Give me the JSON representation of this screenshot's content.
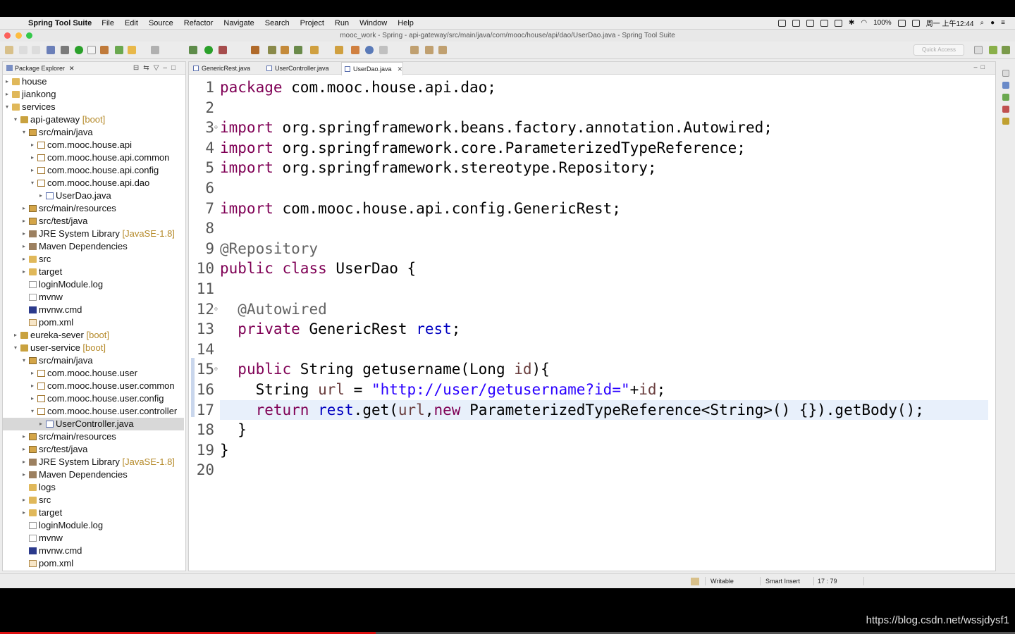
{
  "menubar": {
    "app_name": "Spring Tool Suite",
    "items": [
      "File",
      "Edit",
      "Source",
      "Refactor",
      "Navigate",
      "Search",
      "Project",
      "Run",
      "Window",
      "Help"
    ],
    "battery": "100%",
    "clock": "周一 上午12:44"
  },
  "window": {
    "title": "mooc_work - Spring - api-gateway/src/main/java/com/mooc/house/api/dao/UserDao.java - Spring Tool Suite"
  },
  "toolbar": {
    "quick_access_placeholder": "Quick Access"
  },
  "explorer": {
    "title": "Package Explorer",
    "rows": [
      {
        "label": "house",
        "deco": "",
        "icon": "folder"
      },
      {
        "label": "jiankong",
        "deco": "",
        "icon": "folder"
      },
      {
        "label": "services",
        "deco": "",
        "icon": "folder"
      },
      {
        "label": "api-gateway",
        "deco": "[boot]",
        "icon": "project"
      },
      {
        "label": "src/main/java",
        "deco": "",
        "icon": "srcfolder"
      },
      {
        "label": "com.mooc.house.api",
        "deco": "",
        "icon": "package"
      },
      {
        "label": "com.mooc.house.api.common",
        "deco": "",
        "icon": "package"
      },
      {
        "label": "com.mooc.house.api.config",
        "deco": "",
        "icon": "package"
      },
      {
        "label": "com.mooc.house.api.dao",
        "deco": "",
        "icon": "package"
      },
      {
        "label": "UserDao.java",
        "deco": "",
        "icon": "java"
      },
      {
        "label": "src/main/resources",
        "deco": "",
        "icon": "srcfolder"
      },
      {
        "label": "src/test/java",
        "deco": "",
        "icon": "srcfolder"
      },
      {
        "label": "JRE System Library",
        "deco": "[JavaSE-1.8]",
        "icon": "lib"
      },
      {
        "label": "Maven Dependencies",
        "deco": "",
        "icon": "lib"
      },
      {
        "label": "src",
        "deco": "",
        "icon": "folder"
      },
      {
        "label": "target",
        "deco": "",
        "icon": "folder"
      },
      {
        "label": "loginModule.log",
        "deco": "",
        "icon": "file"
      },
      {
        "label": "mvnw",
        "deco": "",
        "icon": "file"
      },
      {
        "label": "mvnw.cmd",
        "deco": "",
        "icon": "cmd"
      },
      {
        "label": "pom.xml",
        "deco": "",
        "icon": "xml"
      },
      {
        "label": "eureka-sever",
        "deco": "[boot]",
        "icon": "project"
      },
      {
        "label": "user-service",
        "deco": "[boot]",
        "icon": "project"
      },
      {
        "label": "src/main/java",
        "deco": "",
        "icon": "srcfolder"
      },
      {
        "label": "com.mooc.house.user",
        "deco": "",
        "icon": "package"
      },
      {
        "label": "com.mooc.house.user.common",
        "deco": "",
        "icon": "package"
      },
      {
        "label": "com.mooc.house.user.config",
        "deco": "",
        "icon": "package"
      },
      {
        "label": "com.mooc.house.user.controller",
        "deco": "",
        "icon": "package"
      },
      {
        "label": "UserController.java",
        "deco": "",
        "icon": "java"
      },
      {
        "label": "src/main/resources",
        "deco": "",
        "icon": "srcfolder"
      },
      {
        "label": "src/test/java",
        "deco": "",
        "icon": "srcfolder"
      },
      {
        "label": "JRE System Library",
        "deco": "[JavaSE-1.8]",
        "icon": "lib"
      },
      {
        "label": "Maven Dependencies",
        "deco": "",
        "icon": "lib"
      },
      {
        "label": "logs",
        "deco": "",
        "icon": "folder"
      },
      {
        "label": "src",
        "deco": "",
        "icon": "folder"
      },
      {
        "label": "target",
        "deco": "",
        "icon": "folder"
      },
      {
        "label": "loginModule.log",
        "deco": "",
        "icon": "file"
      },
      {
        "label": "mvnw",
        "deco": "",
        "icon": "file"
      },
      {
        "label": "mvnw.cmd",
        "deco": "",
        "icon": "cmd"
      },
      {
        "label": "pom.xml",
        "deco": "",
        "icon": "xml"
      }
    ]
  },
  "editor": {
    "tabs": [
      {
        "label": "GenericRest.java",
        "active": false
      },
      {
        "label": "UserController.java",
        "active": false
      },
      {
        "label": "UserDao.java",
        "active": true
      }
    ],
    "lines": [
      {
        "n": "1",
        "tokens": [
          [
            "kw",
            "package"
          ],
          [
            "t",
            " com.mooc.house.api.dao;"
          ]
        ]
      },
      {
        "n": "2",
        "tokens": []
      },
      {
        "n": "3",
        "tokens": [
          [
            "kw",
            "import"
          ],
          [
            "t",
            " org.springframework.beans.factory.annotation.Autowired;"
          ]
        ]
      },
      {
        "n": "4",
        "tokens": [
          [
            "kw",
            "import"
          ],
          [
            "t",
            " org.springframework.core.ParameterizedTypeReference;"
          ]
        ]
      },
      {
        "n": "5",
        "tokens": [
          [
            "kw",
            "import"
          ],
          [
            "t",
            " org.springframework.stereotype.Repository;"
          ]
        ]
      },
      {
        "n": "6",
        "tokens": []
      },
      {
        "n": "7",
        "tokens": [
          [
            "kw",
            "import"
          ],
          [
            "t",
            " com.mooc.house.api.config.GenericRest;"
          ]
        ]
      },
      {
        "n": "8",
        "tokens": []
      },
      {
        "n": "9",
        "tokens": [
          [
            "ann",
            "@Repository"
          ]
        ]
      },
      {
        "n": "10",
        "tokens": [
          [
            "kw",
            "public"
          ],
          [
            "t",
            " "
          ],
          [
            "kw",
            "class"
          ],
          [
            "t",
            " UserDao {"
          ]
        ]
      },
      {
        "n": "11",
        "tokens": []
      },
      {
        "n": "12",
        "tokens": [
          [
            "t",
            "  "
          ],
          [
            "ann",
            "@Autowired"
          ]
        ]
      },
      {
        "n": "13",
        "tokens": [
          [
            "t",
            "  "
          ],
          [
            "kw",
            "private"
          ],
          [
            "t",
            " GenericRest "
          ],
          [
            "fld",
            "rest"
          ],
          [
            "t",
            ";"
          ]
        ]
      },
      {
        "n": "14",
        "tokens": []
      },
      {
        "n": "15",
        "tokens": [
          [
            "t",
            "  "
          ],
          [
            "kw",
            "public"
          ],
          [
            "t",
            " String getusername(Long "
          ],
          [
            "var",
            "id"
          ],
          [
            "t",
            "){"
          ]
        ]
      },
      {
        "n": "16",
        "tokens": [
          [
            "t",
            "    String "
          ],
          [
            "var",
            "url"
          ],
          [
            "t",
            " = "
          ],
          [
            "str",
            "\"http://user/getusername?id=\""
          ],
          [
            "t",
            "+"
          ],
          [
            "var",
            "id"
          ],
          [
            "t",
            ";"
          ]
        ]
      },
      {
        "n": "17",
        "tokens": [
          [
            "t",
            "    "
          ],
          [
            "kw",
            "return"
          ],
          [
            "t",
            " "
          ],
          [
            "fld",
            "rest"
          ],
          [
            "t",
            ".get("
          ],
          [
            "var",
            "url"
          ],
          [
            "t",
            ","
          ],
          [
            "kw",
            "new"
          ],
          [
            "t",
            " ParameterizedTypeReference<String>() {}).getBody();"
          ]
        ]
      },
      {
        "n": "18",
        "tokens": [
          [
            "t",
            "  }"
          ]
        ]
      },
      {
        "n": "19",
        "tokens": [
          [
            "t",
            "}"
          ]
        ]
      },
      {
        "n": "20",
        "tokens": []
      }
    ],
    "current_line": 17
  },
  "statusbar": {
    "mode": "Writable",
    "insert": "Smart Insert",
    "position": "17 : 79"
  },
  "watermark": "https://blog.csdn.net/wssjdysf1",
  "colors": {
    "keyword": "#7f0055",
    "annotation": "#646464",
    "string": "#2a00ff",
    "field": "#0000c0",
    "local": "#6a3e3e",
    "current_line": "#e8f0fb"
  }
}
